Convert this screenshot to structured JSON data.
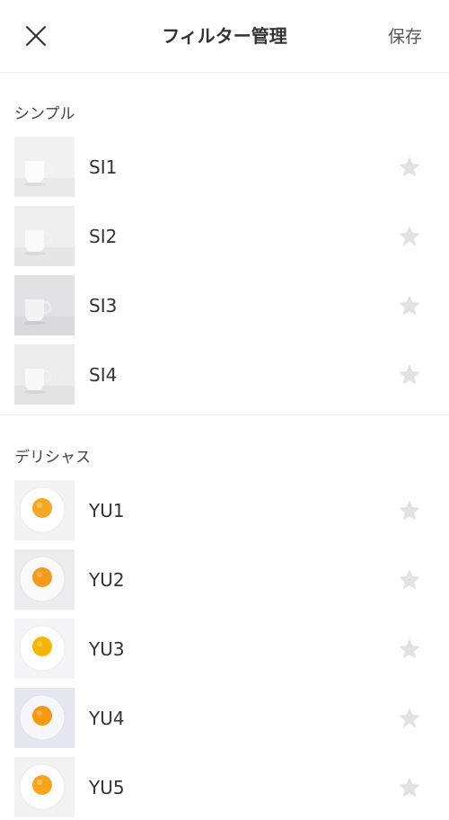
{
  "header": {
    "title": "フィルター管理",
    "save_label": "保存"
  },
  "sections": [
    {
      "label": "シンプル",
      "items": [
        {
          "label": "SI1"
        },
        {
          "label": "SI2"
        },
        {
          "label": "SI3"
        },
        {
          "label": "SI4"
        }
      ]
    },
    {
      "label": "デリシャス",
      "items": [
        {
          "label": "YU1"
        },
        {
          "label": "YU2"
        },
        {
          "label": "YU3"
        },
        {
          "label": "YU4"
        },
        {
          "label": "YU5"
        }
      ]
    }
  ],
  "colors": {
    "star": "#e2e2e2",
    "divider": "#ececec",
    "text": "#333333"
  },
  "icons": {
    "close": "close-icon",
    "favorite": "star-icon"
  }
}
